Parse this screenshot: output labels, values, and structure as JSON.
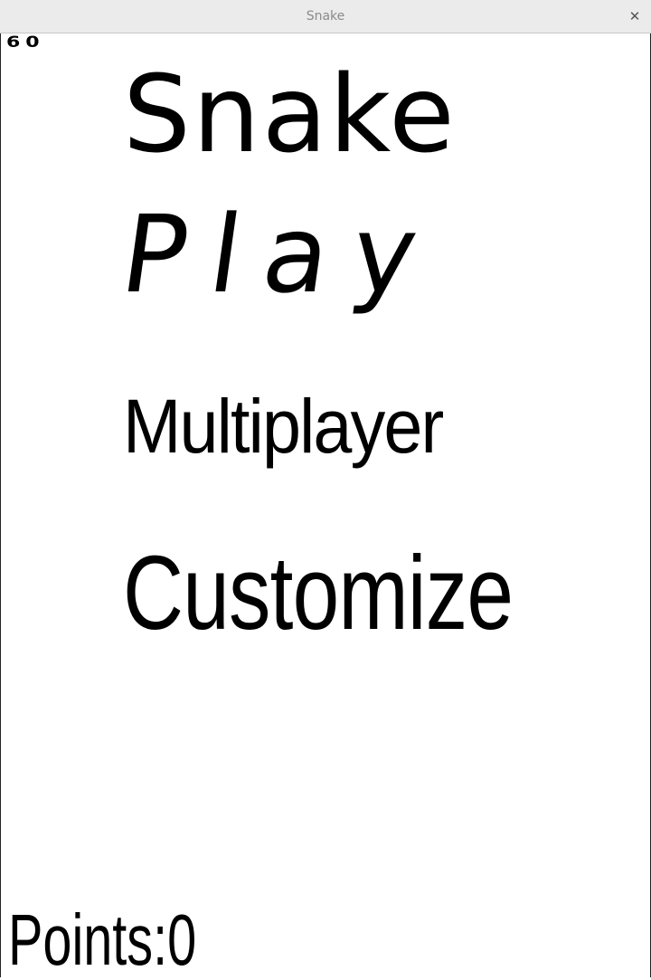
{
  "window": {
    "title": "Snake",
    "close_glyph": "✕"
  },
  "hud": {
    "fps": "60",
    "points_text": "Points:0"
  },
  "menu": {
    "title": "Snake",
    "items": [
      {
        "label": "Play"
      },
      {
        "label": "Multiplayer"
      },
      {
        "label": "Customize"
      }
    ]
  },
  "colors": {
    "background": "#ffffff",
    "ink": "#000000",
    "titlebar": "#ebebeb"
  }
}
